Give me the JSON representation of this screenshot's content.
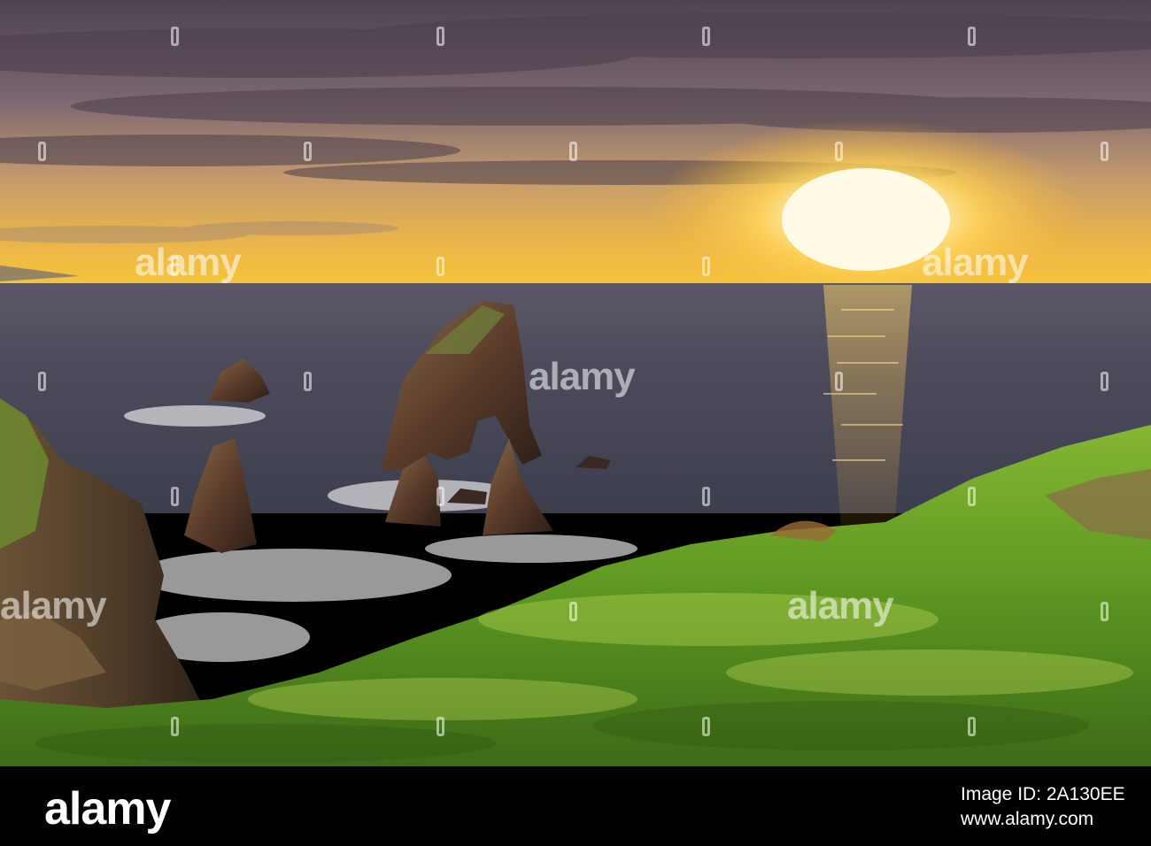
{
  "photo": {
    "scene": "coastal sunset with sea stacks and grassy cliff",
    "sky_top_color": "#5b4c59",
    "sky_horizon_color": "#f3c03a",
    "sun_color": "#fff8d2",
    "sea_color": "#4a4a5a",
    "grass_color": "#5f9a22",
    "rock_color": "#4a3226"
  },
  "watermark": {
    "text": "alamy"
  },
  "footer": {
    "brand": "alamy",
    "image_id": "Image ID: 2A130EE",
    "url": "www.alamy.com"
  }
}
